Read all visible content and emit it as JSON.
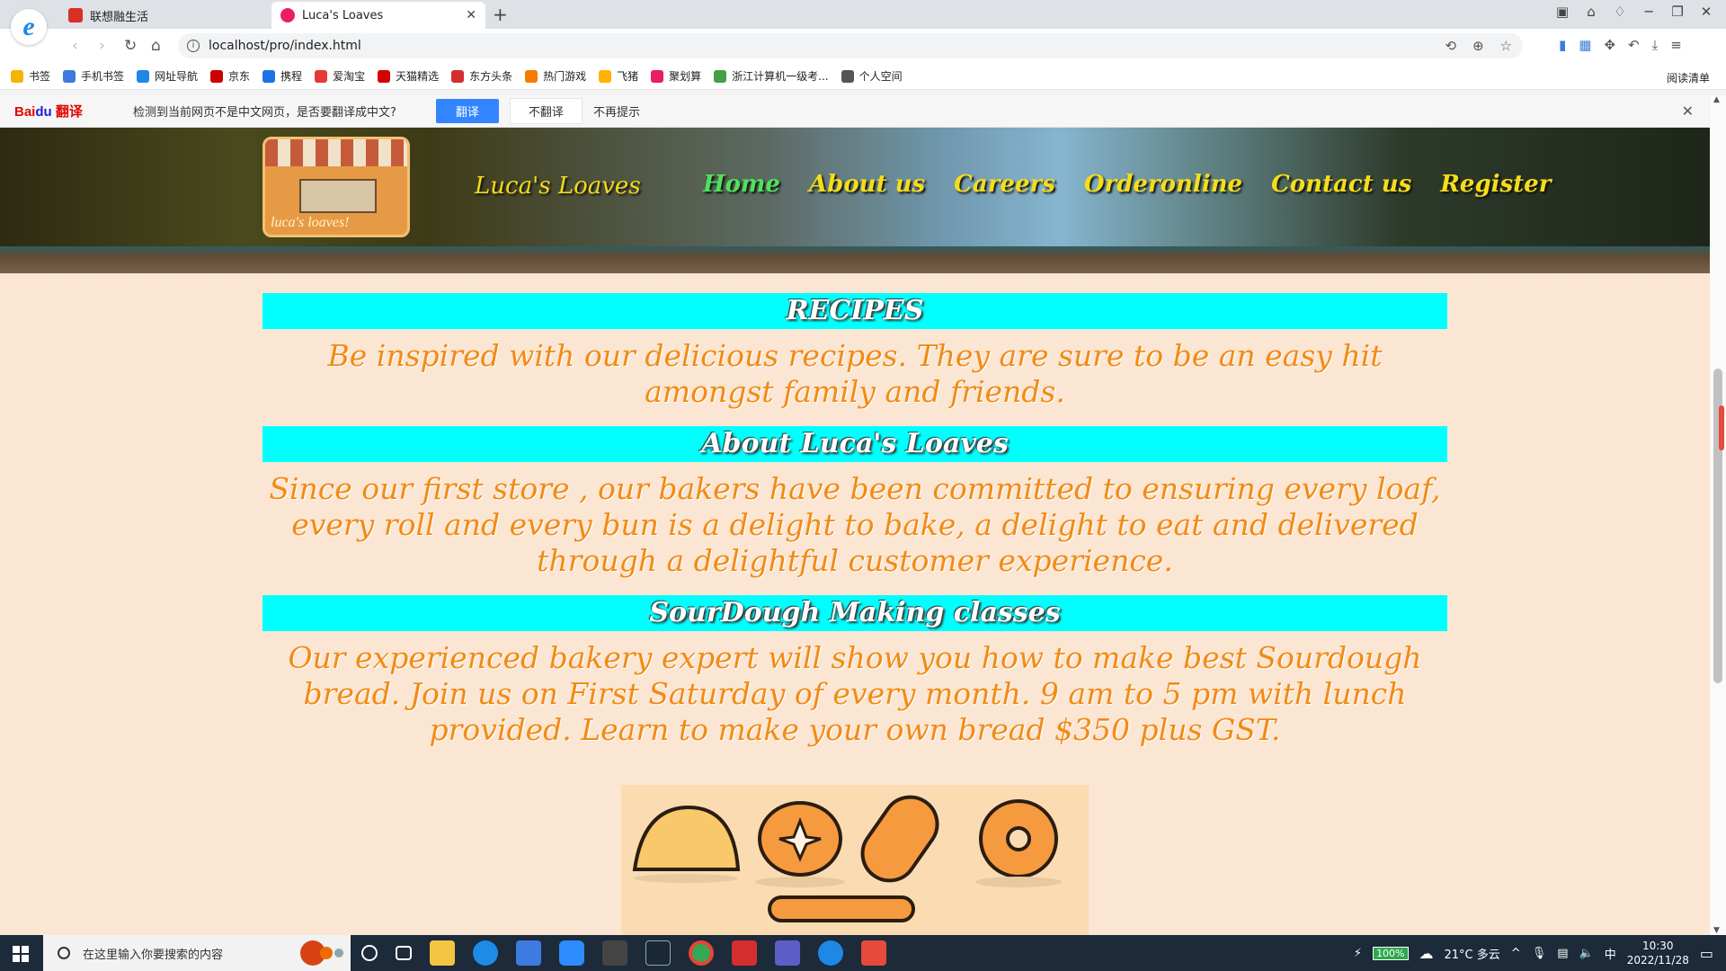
{
  "browser": {
    "tabs": [
      {
        "title": "联想融生活",
        "active": false,
        "favicon_color": "#d93025"
      },
      {
        "title": "Luca's Loaves",
        "active": true,
        "favicon_color": "#e91e63"
      }
    ],
    "address": "localhost/pro/index.html",
    "bookmarks": [
      {
        "label": "书签",
        "color": "#f5b400"
      },
      {
        "label": "手机书签",
        "color": "#3d7be0"
      },
      {
        "label": "网址导航",
        "color": "#1e88e5"
      },
      {
        "label": "京东",
        "color": "#c00"
      },
      {
        "label": "携程",
        "color": "#1a73e8"
      },
      {
        "label": "爱淘宝",
        "color": "#e53935"
      },
      {
        "label": "天猫精选",
        "color": "#d50000"
      },
      {
        "label": "东方头条",
        "color": "#d32f2f"
      },
      {
        "label": "热门游戏",
        "color": "#f57c00"
      },
      {
        "label": "飞猪",
        "color": "#ffb300"
      },
      {
        "label": "聚划算",
        "color": "#e91e63"
      },
      {
        "label": "浙江计算机一级考...",
        "color": "#43a047"
      },
      {
        "label": "个人空间",
        "color": "#555"
      }
    ],
    "reading_list": "阅读清单"
  },
  "translate_bar": {
    "logo": "Bai du 翻译",
    "message": "检测到当前网页不是中文网页，是否要翻译成中文?",
    "translate": "翻译",
    "no_translate": "不翻译",
    "never": "不再提示"
  },
  "site": {
    "brand": "Luca's Loaves",
    "logo_text": "luca's loaves!",
    "nav": [
      {
        "label": "Home",
        "current": true
      },
      {
        "label": "About us",
        "current": false
      },
      {
        "label": "Careers",
        "current": false
      },
      {
        "label": "Orderonline",
        "current": false
      },
      {
        "label": "Contact us",
        "current": false
      },
      {
        "label": "Register",
        "current": false
      }
    ],
    "sections": [
      {
        "heading": "RECIPES",
        "text": "Be inspired with our delicious recipes. They are sure to be an easy hit amongst family and friends."
      },
      {
        "heading": "About Luca's Loaves",
        "text": "Since our first store , our bakers have been committed to ensuring every loaf, every roll and every bun is a delight to bake, a delight to eat and delivered through a delightful customer experience."
      },
      {
        "heading": "SourDough Making classes",
        "text": "Our experienced bakery expert will show you how to make best Sourdough bread. Join us on First Saturday of every month. 9 am to 5 pm with lunch provided. Learn to make your own bread $350 plus GST."
      }
    ]
  },
  "taskbar": {
    "search_placeholder": "在这里输入你要搜索的内容",
    "battery": "100%",
    "weather": "21°C 多云",
    "ime": "中",
    "time": "10:30",
    "date": "2022/11/28"
  }
}
